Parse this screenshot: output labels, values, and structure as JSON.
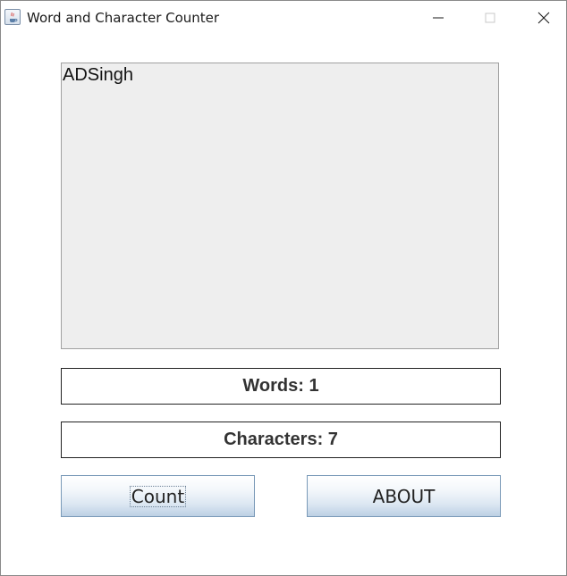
{
  "window": {
    "title": "Word and Character Counter"
  },
  "titlebar_icons": {
    "app": "java-icon",
    "minimize": "minimize-icon",
    "maximize": "maximize-icon",
    "close": "close-icon"
  },
  "text_area": {
    "value": "ADSingh"
  },
  "results": {
    "words": "Words: 1",
    "characters": "Characters: 7"
  },
  "buttons": {
    "count_label": "Count",
    "about_label": "ABOUT"
  },
  "colors": {
    "text_area_bg": "#eeeeee",
    "button_border": "#7a9ab8"
  }
}
